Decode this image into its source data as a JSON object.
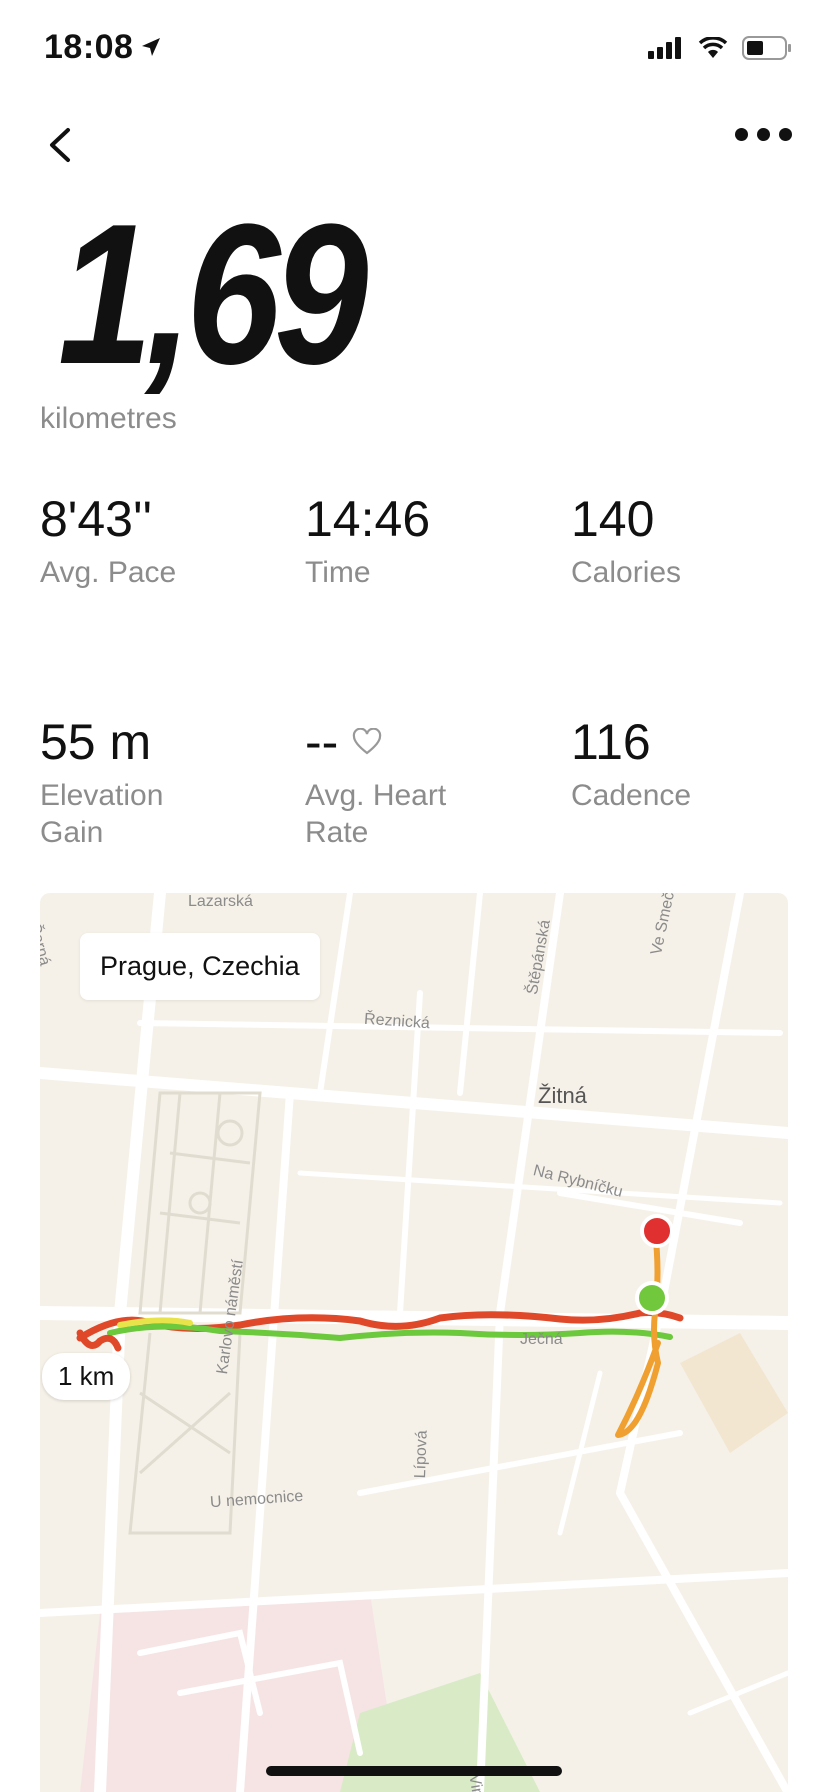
{
  "status": {
    "time": "18:08",
    "icons": [
      "location-arrow-icon",
      "signal-icon",
      "wifi-icon",
      "battery-icon"
    ]
  },
  "nav": {
    "back_icon": "chevron-left-icon",
    "more_icon": "ellipsis-icon"
  },
  "distance": {
    "value": "1,69",
    "unit": "kilometres"
  },
  "stats": {
    "pace": {
      "value": "8'43''",
      "label": "Avg. Pace"
    },
    "time": {
      "value": "14:46",
      "label": "Time"
    },
    "calories": {
      "value": "140",
      "label": "Calories"
    },
    "elevation": {
      "value": "55 m",
      "label": "Elevation Gain"
    },
    "heart_rate": {
      "value": "--",
      "label": "Avg. Heart Rate",
      "icon": "heart-icon"
    },
    "cadence": {
      "value": "116",
      "label": "Cadence"
    }
  },
  "map": {
    "location": "Prague, Czechia",
    "scale": "1 km",
    "streets": {
      "lazarska": "Lazarská",
      "cerna": "Černá",
      "reznicka": "Řeznická",
      "stepanska": "Štěpánská",
      "ve_smeck": "Ve Smečk",
      "zitna": "Žitná",
      "na_rybnicku": "Na Rybníčku",
      "karlovo": "Karlovo náměstí",
      "jecna": "Ječná",
      "lipova": "Lípová",
      "u_nemocnice": "U nemocnice",
      "vinicna": "Viničn"
    },
    "colors": {
      "route_fast": "#6cc83c",
      "route_mid": "#f0a030",
      "route_slow": "#e0482a",
      "start": "#72c83c",
      "end": "#e03030"
    }
  }
}
